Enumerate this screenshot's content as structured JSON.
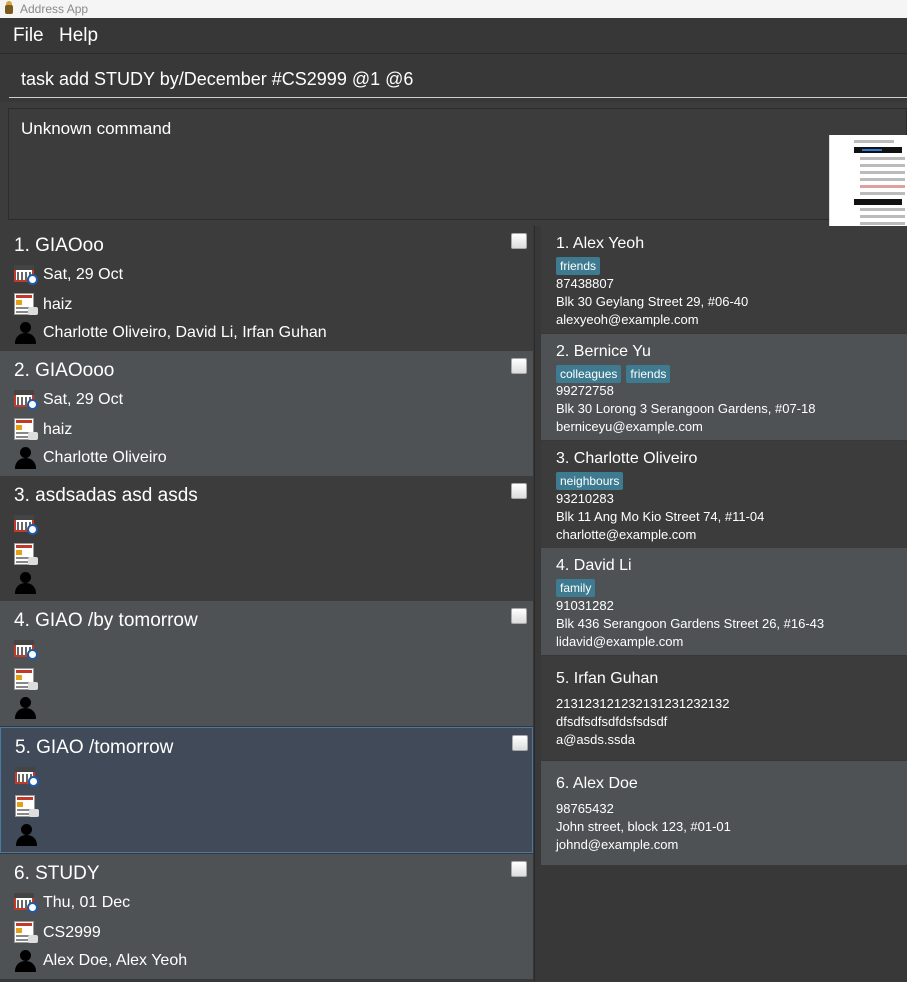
{
  "window": {
    "title": "Address App"
  },
  "menu": {
    "file": "File",
    "help": "Help"
  },
  "command": {
    "value": "task add STUDY by/December #CS2999 @1 @6"
  },
  "result": {
    "message": "Unknown command"
  },
  "tasks": [
    {
      "title": "1. GIAOoo",
      "date": "Sat, 29 Oct",
      "tags": "haiz",
      "people": "Charlotte Oliveiro, David Li, Irfan Guhan"
    },
    {
      "title": "2. GIAOooo",
      "date": "Sat, 29 Oct",
      "tags": "haiz",
      "people": "Charlotte Oliveiro"
    },
    {
      "title": "3. asdsadas asd asds",
      "date": "",
      "tags": "",
      "people": ""
    },
    {
      "title": "4. GIAO /by tomorrow",
      "date": "",
      "tags": "",
      "people": ""
    },
    {
      "title": "5. GIAO  /tomorrow",
      "date": "",
      "tags": "",
      "people": ""
    },
    {
      "title": "6. STUDY",
      "date": "Thu, 01 Dec",
      "tags": "CS2999",
      "people": "Alex Doe, Alex Yeoh"
    }
  ],
  "persons": [
    {
      "name": "1.  Alex Yeoh",
      "tags": [
        "friends"
      ],
      "phone": "87438807",
      "address": "Blk 30 Geylang Street 29, #06-40",
      "email": "alexyeoh@example.com"
    },
    {
      "name": "2.  Bernice Yu",
      "tags": [
        "colleagues",
        "friends"
      ],
      "phone": "99272758",
      "address": "Blk 30 Lorong 3 Serangoon Gardens, #07-18",
      "email": "berniceyu@example.com"
    },
    {
      "name": "3.  Charlotte Oliveiro",
      "tags": [
        "neighbours"
      ],
      "phone": "93210283",
      "address": "Blk 11 Ang Mo Kio Street 74, #11-04",
      "email": "charlotte@example.com"
    },
    {
      "name": "4.  David Li",
      "tags": [
        "family"
      ],
      "phone": "91031282",
      "address": "Blk 436 Serangoon Gardens Street 26, #16-43",
      "email": "lidavid@example.com"
    },
    {
      "name": "5.  Irfan Guhan",
      "tags": [],
      "phone": "21312312123213123123213​2",
      "address": "dfsdfsdfsdfdsfsdsdf",
      "email": "a@asds.ssda"
    },
    {
      "name": "6.  Alex Doe",
      "tags": [],
      "phone": "98765432",
      "address": "John street, block 123, #01-01",
      "email": "johnd@example.com"
    }
  ]
}
